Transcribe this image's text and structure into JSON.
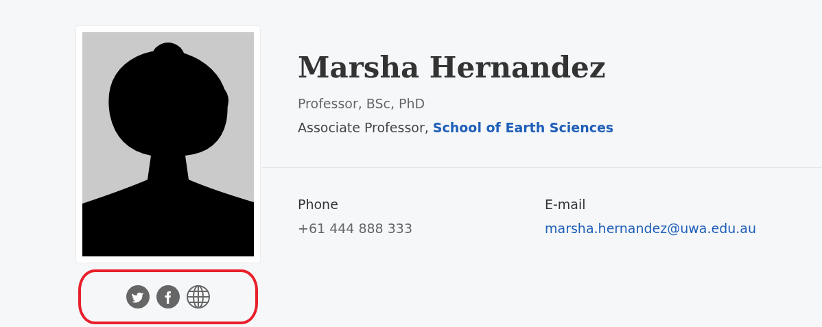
{
  "profile": {
    "social_links": {
      "highlighted": true,
      "items": [
        {
          "kind": "twitter"
        },
        {
          "kind": "facebook"
        },
        {
          "kind": "website"
        }
      ]
    },
    "name": "Marsha Hernandez",
    "degrees": "Professor, BSc, PhD",
    "position": "Associate Professor, ",
    "department": "School of Earth Sciences",
    "contacts": [
      {
        "label": "Phone",
        "value": "+61 444 888 333",
        "kind": "text"
      },
      {
        "label": "E-mail",
        "value": "marsha.hernandez@uwa.edu.au",
        "kind": "link"
      }
    ]
  }
}
